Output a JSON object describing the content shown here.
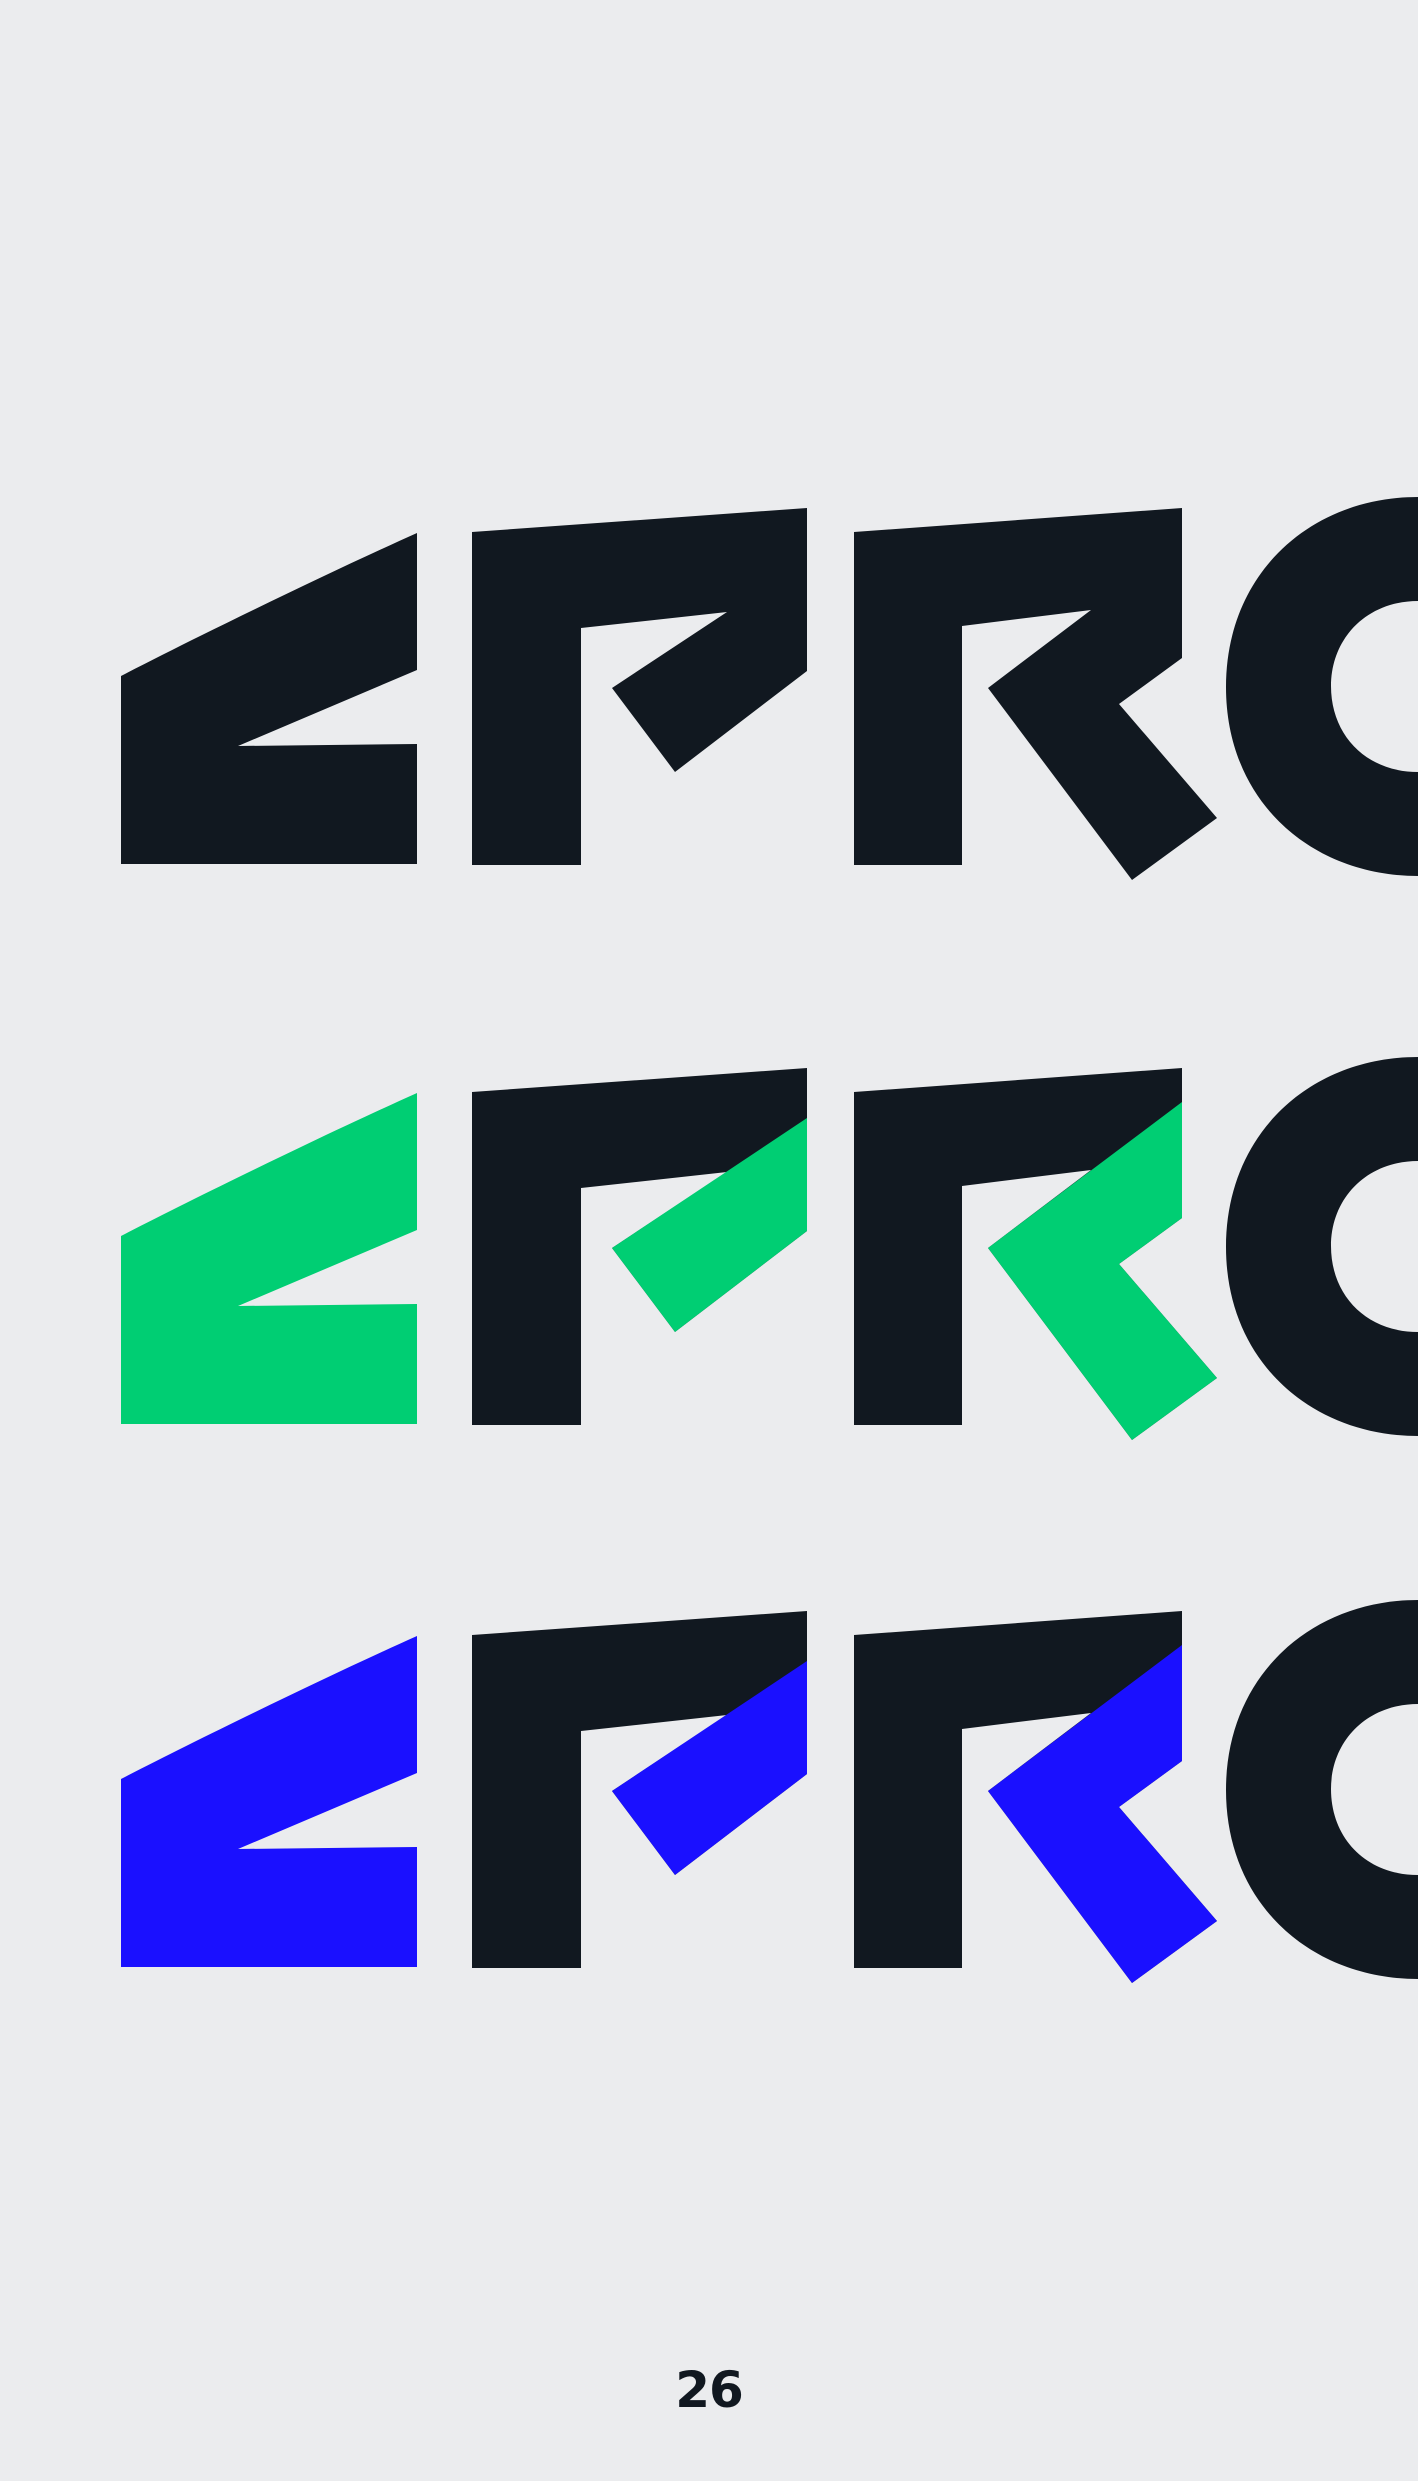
{
  "palette": {
    "background": "#EBECEE",
    "ink": "#111820",
    "green": "#00CE73",
    "blue": "#1A10FF"
  },
  "logo_rows": [
    {
      "variant": "black",
      "accent_color": "#111820"
    },
    {
      "variant": "green",
      "accent_color": "#00CE73"
    },
    {
      "variant": "blue",
      "accent_color": "#1A10FF"
    }
  ],
  "page_number": "26"
}
